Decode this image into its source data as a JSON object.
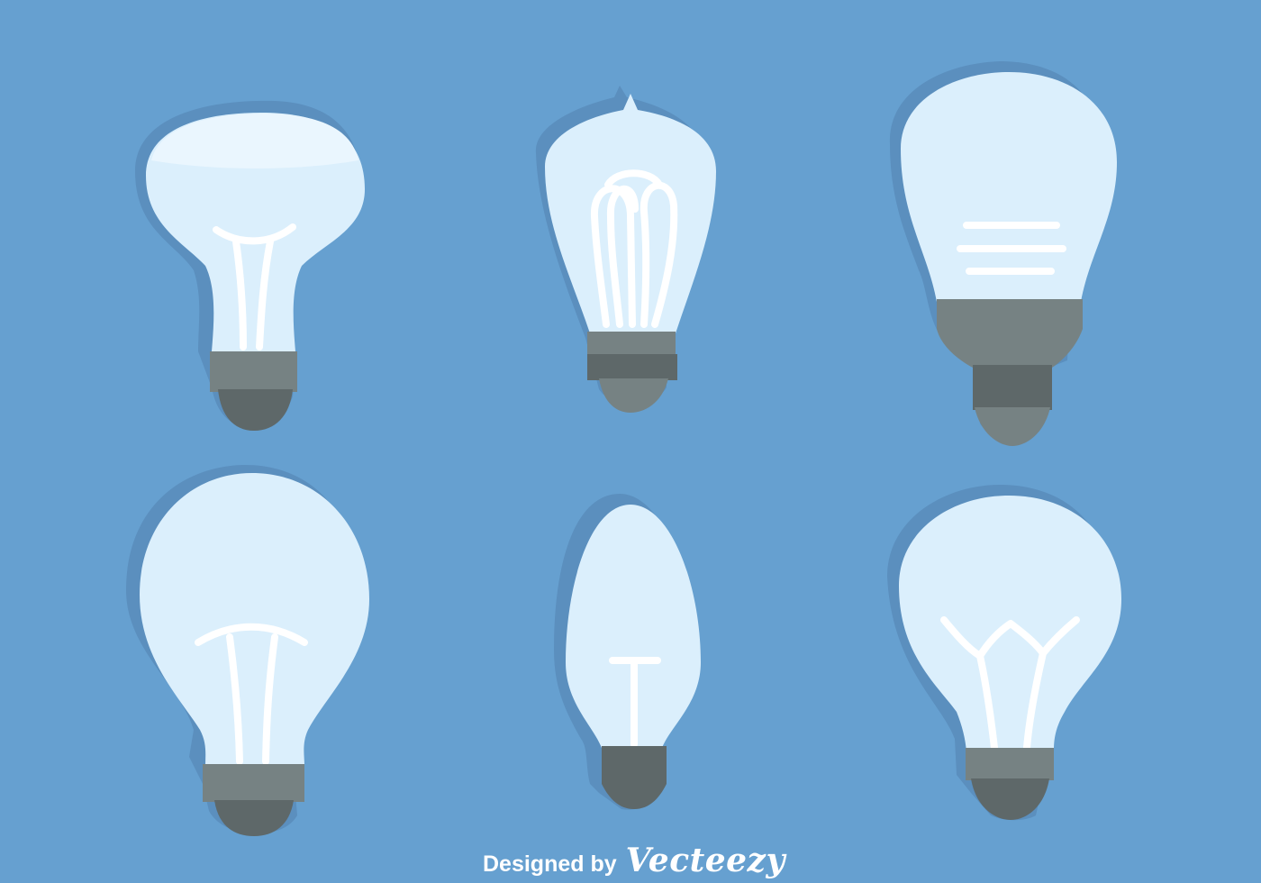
{
  "colors": {
    "background": "#66a0d0",
    "shadow": "#5b8fbe",
    "glass": "#dbeffc",
    "glass_highlight": "#eaf6fe",
    "filament": "#ffffff",
    "base_light": "#768283",
    "base_dark": "#5e6869"
  },
  "bulbs": [
    {
      "name": "reflector-bulb-icon",
      "label": "reflector bulb"
    },
    {
      "name": "edison-bulb-icon",
      "label": "edison filament bulb"
    },
    {
      "name": "led-bulb-icon",
      "label": "led bulb"
    },
    {
      "name": "round-bulb-icon",
      "label": "round bulb"
    },
    {
      "name": "candle-bulb-icon",
      "label": "candle bulb"
    },
    {
      "name": "classic-bulb-icon",
      "label": "classic filament bulb"
    }
  ],
  "credit": {
    "prefix": "Designed by",
    "brand": "Vecteezy"
  }
}
